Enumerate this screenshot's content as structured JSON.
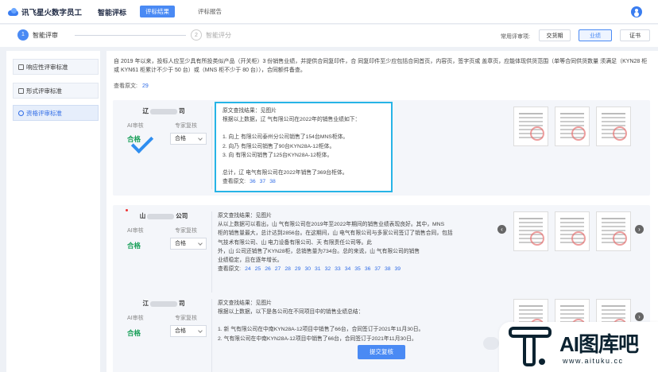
{
  "header": {
    "logo": "讯飞星火数字员工",
    "title": "智能评标",
    "tabs": [
      {
        "label": "评标结果",
        "active": true
      },
      {
        "label": "评标报告",
        "active": false
      }
    ]
  },
  "steps": [
    {
      "num": "1",
      "label": "智能评审",
      "active": true
    },
    {
      "num": "2",
      "label": "智能评分",
      "active": false
    }
  ],
  "rules": {
    "label": "常用评审项:",
    "buttons": [
      {
        "label": "交货期",
        "active": false
      },
      {
        "label": "业绩",
        "active": true
      },
      {
        "label": "证书",
        "active": false
      }
    ]
  },
  "sidebar": {
    "items": [
      {
        "label": "响应性评审标准",
        "active": false
      },
      {
        "label": "形式评审标准",
        "active": false
      },
      {
        "label": "资格评审标准",
        "active": true
      }
    ]
  },
  "intro": {
    "text": "自 2019 年以来，投标人应至少具有所投类似产品（开关柜）3 份销售业绩，并提供合同复印件，合 同复印件至少应包括合同首页，内容页，签字页或 盖章页，应能体现供货范围（单等合同供货数量 须满足（KYN28 柜或 KYN61 柜累计不少于 50 台）或（MNS 柜不少于 80 台）），合同额件备查。",
    "ref_label": "查看原文:",
    "ref_pages": [
      "29"
    ]
  },
  "cards": [
    {
      "company_prefix": "辽",
      "company_suffix": "司",
      "ai_label": "AI审核",
      "expert_label": "专家复核",
      "ai_result": "合格",
      "expert_value": "合格",
      "lines": [
        "原文查找结果：见图片",
        "根据以上数据，辽  气有限公司在2022年的销售业绩如下：",
        "",
        "1. 向上  有限公司泰州分公司销售了154台MNS柜体。",
        "2. 向乃  有限公司销售了90台KYN28A-12柜体。",
        "3. 向  有限公司销售了125台KYN28A-12柜体。",
        "",
        "总计，辽  电气有限公司在2022年销售了369台柜体。"
      ],
      "ref_label": "查看原文:",
      "ref_pages": [
        "36",
        "37",
        "38"
      ]
    },
    {
      "company_prefix": "山",
      "company_suffix": "公司",
      "ai_label": "AI审核",
      "expert_label": "专家复核",
      "ai_result": "合格",
      "expert_value": "合格",
      "lines": [
        "原文查找结果：见图片",
        "从以上数据可以看出，山  气有限公司在2019年至2022年期间的销售业绩表现良好。其中，MNS",
        "柜的销售量最大，总计达到2856台。在这期间，山  电气有限公司与多家公司签订了销售合同，包括",
        "  气技术有限公司、山  电力设备有限公司、天  有限责任公司等。此",
        "外，山  公司还销售了KYN28柜，总销售量为734台。总的来说，山  气有限公司的销售",
        "业绩稳定，且在逐年增长。"
      ],
      "ref_label": "查看原文:",
      "ref_pages": [
        "24",
        "25",
        "26",
        "27",
        "28",
        "29",
        "30",
        "31",
        "32",
        "33",
        "34",
        "35",
        "36",
        "37",
        "38",
        "39"
      ]
    },
    {
      "company_prefix": "江",
      "company_suffix": "司",
      "ai_label": "AI审核",
      "expert_label": "专家复核",
      "ai_result": "合格",
      "expert_value": "合格",
      "lines": [
        "原文查找结果：见图片",
        "根据以上数据，以下是各公司在不同项目中的销售业绩总结：",
        "",
        "1. 新  气有限公司在中南KYN28A-12项目中销售了66台，合同签订于2021年11月30日。",
        "2.  气有限公司在中南KYN28A-12项目中销售了66台，合同签订于2021年11月30日。"
      ],
      "ref_label": "",
      "ref_pages": []
    }
  ],
  "footer": {
    "submit_label": "提交复核"
  },
  "watermark": {
    "text": "AI图库吧",
    "url": "www.aituku.cc"
  },
  "colors": {
    "accent": "#4a8af4",
    "pass": "#1aa05a",
    "highlight": "#27b4e6"
  }
}
